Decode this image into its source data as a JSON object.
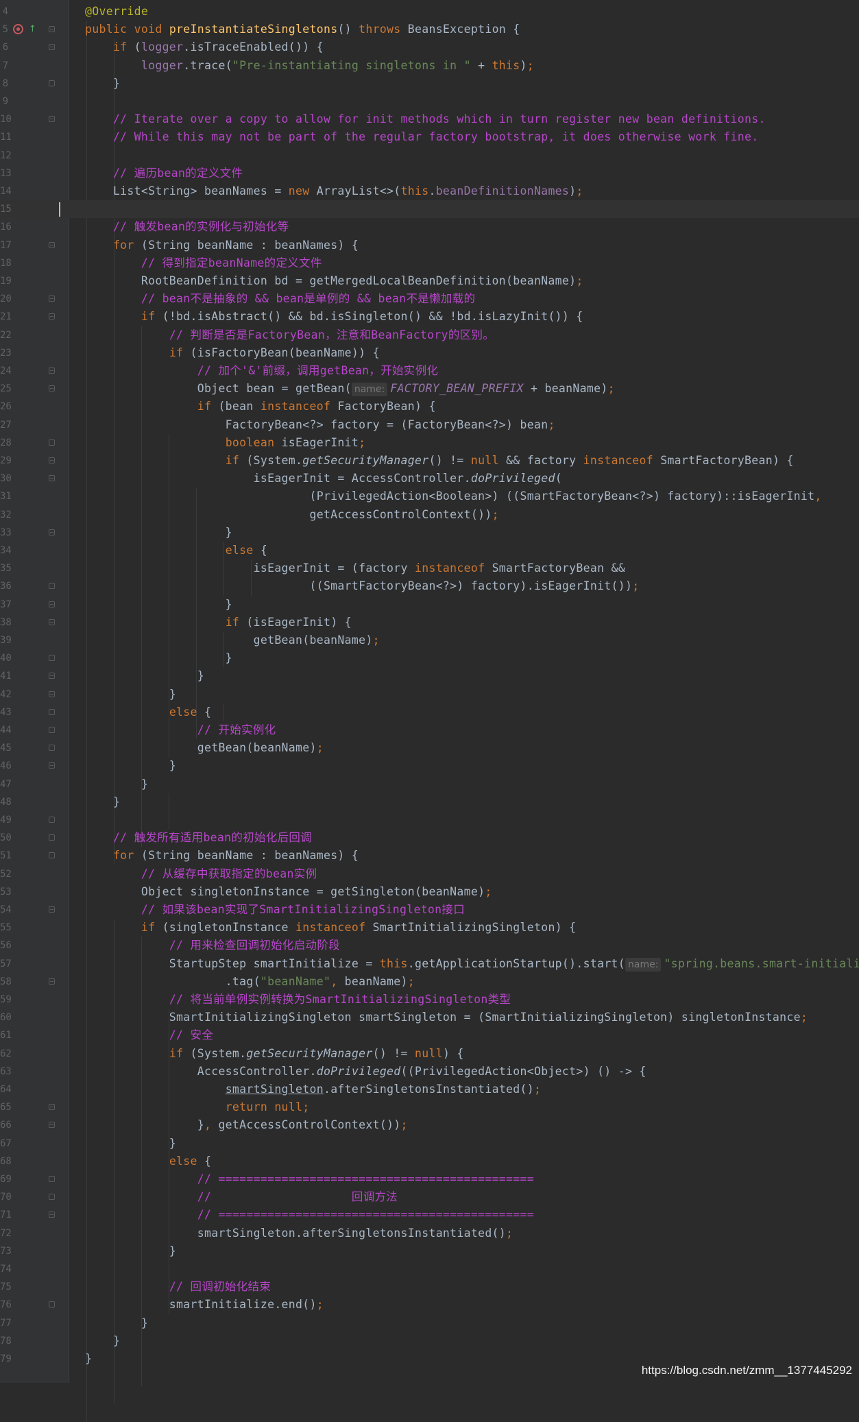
{
  "editor": {
    "lines": [
      {
        "n": "4",
        "t": [
          [
            "an",
            "@Override"
          ]
        ]
      },
      {
        "n": "5",
        "t": [
          [
            "kw",
            "public "
          ],
          [
            "kw",
            "void "
          ],
          [
            "fn",
            "preInstantiateSingletons"
          ],
          [
            "",
            "() "
          ],
          [
            "kw",
            "throws "
          ],
          [
            "",
            "BeansException {"
          ]
        ]
      },
      {
        "n": "6",
        "t": [
          [
            "",
            "    "
          ],
          [
            "kw",
            "if "
          ],
          [
            "",
            "("
          ],
          [
            "fd",
            "logger"
          ],
          [
            "",
            ".isTraceEnabled()) {"
          ]
        ]
      },
      {
        "n": "7",
        "t": [
          [
            "",
            "        "
          ],
          [
            "fd",
            "logger"
          ],
          [
            "",
            ".trace("
          ],
          [
            "st",
            "\"Pre-instantiating singletons in \" "
          ],
          [
            "",
            "+ "
          ],
          [
            "kw",
            "this"
          ],
          [
            "",
            ")"
          ],
          [
            "kw",
            ";"
          ]
        ]
      },
      {
        "n": "8",
        "t": [
          [
            "",
            "    }"
          ]
        ]
      },
      {
        "n": "9",
        "t": []
      },
      {
        "n": "10",
        "t": [
          [
            "",
            "    "
          ],
          [
            "cm",
            "// Iterate over a copy to allow for init methods which in turn register new bean definitions."
          ]
        ]
      },
      {
        "n": "11",
        "t": [
          [
            "",
            "    "
          ],
          [
            "cm",
            "// While this may not be part of the regular factory bootstrap, it does otherwise work fine."
          ]
        ]
      },
      {
        "n": "12",
        "t": []
      },
      {
        "n": "13",
        "t": [
          [
            "",
            "    "
          ],
          [
            "cm",
            "// 遍历bean的定义文件"
          ]
        ]
      },
      {
        "n": "14",
        "t": [
          [
            "",
            "    List<String> beanNames = "
          ],
          [
            "kw",
            "new "
          ],
          [
            "",
            "ArrayList<>("
          ],
          [
            "kw",
            "this"
          ],
          [
            "",
            "."
          ],
          [
            "fd",
            "beanDefinitionNames"
          ],
          [
            "",
            ")"
          ],
          [
            "kw",
            ";"
          ]
        ]
      },
      {
        "n": "15",
        "t": []
      },
      {
        "n": "16",
        "t": [
          [
            "",
            "    "
          ],
          [
            "cm",
            "// 触发bean的实例化与初始化等"
          ]
        ]
      },
      {
        "n": "17",
        "t": [
          [
            "",
            "    "
          ],
          [
            "kw",
            "for "
          ],
          [
            "",
            "(String beanName : beanNames) {"
          ]
        ]
      },
      {
        "n": "18",
        "t": [
          [
            "",
            "        "
          ],
          [
            "cm",
            "// 得到指定beanName的定义文件"
          ]
        ]
      },
      {
        "n": "19",
        "t": [
          [
            "",
            "        RootBeanDefinition bd = getMergedLocalBeanDefinition(beanName)"
          ],
          [
            "kw",
            ";"
          ]
        ]
      },
      {
        "n": "20",
        "t": [
          [
            "",
            "        "
          ],
          [
            "cm",
            "// bean不是抽象的 && bean是单例的 && bean不是懒加载的"
          ]
        ]
      },
      {
        "n": "21",
        "t": [
          [
            "",
            "        "
          ],
          [
            "kw",
            "if "
          ],
          [
            "",
            "(!bd.isAbstract() && bd.isSingleton() && !bd.isLazyInit()) {"
          ]
        ]
      },
      {
        "n": "22",
        "t": [
          [
            "",
            "            "
          ],
          [
            "cm",
            "// 判断是否是FactoryBean，注意和BeanFactory的区别。"
          ]
        ]
      },
      {
        "n": "23",
        "t": [
          [
            "",
            "            "
          ],
          [
            "kw",
            "if "
          ],
          [
            "",
            "(isFactoryBean(beanName)) {"
          ]
        ]
      },
      {
        "n": "24",
        "t": [
          [
            "",
            "                "
          ],
          [
            "cm",
            "// 加个'&'前缀，调用getBean，开始实例化"
          ]
        ]
      },
      {
        "n": "25",
        "t": [
          [
            "",
            "                Object bean = getBean("
          ],
          [
            "hint",
            "name:"
          ],
          [
            "cs",
            "FACTORY_BEAN_PREFIX "
          ],
          [
            "",
            "+ beanName)"
          ],
          [
            "kw",
            ";"
          ]
        ]
      },
      {
        "n": "26",
        "t": [
          [
            "",
            "                "
          ],
          [
            "kw",
            "if "
          ],
          [
            "",
            "(bean "
          ],
          [
            "kw",
            "instanceof "
          ],
          [
            "",
            "FactoryBean) {"
          ]
        ]
      },
      {
        "n": "27",
        "t": [
          [
            "",
            "                    FactoryBean<?> factory = (FactoryBean<?>) bean"
          ],
          [
            "kw",
            ";"
          ]
        ]
      },
      {
        "n": "28",
        "t": [
          [
            "",
            "                    "
          ],
          [
            "kw",
            "boolean "
          ],
          [
            "",
            "isEagerInit"
          ],
          [
            "kw",
            ";"
          ]
        ]
      },
      {
        "n": "29",
        "t": [
          [
            "",
            "                    "
          ],
          [
            "kw",
            "if "
          ],
          [
            "",
            "(System."
          ],
          [
            "sm",
            "getSecurityManager"
          ],
          [
            "",
            "() != "
          ],
          [
            "kw",
            "null "
          ],
          [
            "",
            "&& factory "
          ],
          [
            "kw",
            "instanceof "
          ],
          [
            "",
            "SmartFactoryBean) {"
          ]
        ]
      },
      {
        "n": "30",
        "t": [
          [
            "",
            "                        isEagerInit = AccessController."
          ],
          [
            "sm",
            "doPrivileged"
          ],
          [
            "",
            "("
          ]
        ]
      },
      {
        "n": "31",
        "t": [
          [
            "",
            "                                (PrivilegedAction<Boolean>) ((SmartFactoryBean<?>) factory)::isEagerInit"
          ],
          [
            "kw",
            ","
          ]
        ]
      },
      {
        "n": "32",
        "t": [
          [
            "",
            "                                getAccessControlContext())"
          ],
          [
            "kw",
            ";"
          ]
        ]
      },
      {
        "n": "33",
        "t": [
          [
            "",
            "                    }"
          ]
        ]
      },
      {
        "n": "34",
        "t": [
          [
            "",
            "                    "
          ],
          [
            "kw",
            "else "
          ],
          [
            "",
            "{"
          ]
        ]
      },
      {
        "n": "35",
        "t": [
          [
            "",
            "                        isEagerInit = (factory "
          ],
          [
            "kw",
            "instanceof "
          ],
          [
            "",
            "SmartFactoryBean &&"
          ]
        ]
      },
      {
        "n": "36",
        "t": [
          [
            "",
            "                                ((SmartFactoryBean<?>) factory).isEagerInit())"
          ],
          [
            "kw",
            ";"
          ]
        ]
      },
      {
        "n": "37",
        "t": [
          [
            "",
            "                    }"
          ]
        ]
      },
      {
        "n": "38",
        "t": [
          [
            "",
            "                    "
          ],
          [
            "kw",
            "if "
          ],
          [
            "",
            "(isEagerInit) {"
          ]
        ]
      },
      {
        "n": "39",
        "t": [
          [
            "",
            "                        getBean(beanName)"
          ],
          [
            "kw",
            ";"
          ]
        ]
      },
      {
        "n": "40",
        "t": [
          [
            "",
            "                    }"
          ]
        ]
      },
      {
        "n": "41",
        "t": [
          [
            "",
            "                }"
          ]
        ]
      },
      {
        "n": "42",
        "t": [
          [
            "",
            "            }"
          ]
        ]
      },
      {
        "n": "43",
        "t": [
          [
            "",
            "            "
          ],
          [
            "kw",
            "else "
          ],
          [
            "",
            "{"
          ]
        ]
      },
      {
        "n": "44",
        "t": [
          [
            "",
            "                "
          ],
          [
            "cm",
            "// 开始实例化"
          ]
        ]
      },
      {
        "n": "45",
        "t": [
          [
            "",
            "                getBean(beanName)"
          ],
          [
            "kw",
            ";"
          ]
        ]
      },
      {
        "n": "46",
        "t": [
          [
            "",
            "            }"
          ]
        ]
      },
      {
        "n": "47",
        "t": [
          [
            "",
            "        }"
          ]
        ]
      },
      {
        "n": "48",
        "t": [
          [
            "",
            "    }"
          ]
        ]
      },
      {
        "n": "49",
        "t": []
      },
      {
        "n": "50",
        "t": [
          [
            "",
            "    "
          ],
          [
            "cm",
            "// 触发所有适用bean的初始化后回调"
          ]
        ]
      },
      {
        "n": "51",
        "t": [
          [
            "",
            "    "
          ],
          [
            "kw",
            "for "
          ],
          [
            "",
            "(String beanName : beanNames) {"
          ]
        ]
      },
      {
        "n": "52",
        "t": [
          [
            "",
            "        "
          ],
          [
            "cm",
            "// 从缓存中获取指定的bean实例"
          ]
        ]
      },
      {
        "n": "53",
        "t": [
          [
            "",
            "        Object singletonInstance = getSingleton(beanName)"
          ],
          [
            "kw",
            ";"
          ]
        ]
      },
      {
        "n": "54",
        "t": [
          [
            "",
            "        "
          ],
          [
            "cm",
            "// 如果该bean实现了SmartInitializingSingleton接口"
          ]
        ]
      },
      {
        "n": "55",
        "t": [
          [
            "",
            "        "
          ],
          [
            "kw",
            "if "
          ],
          [
            "",
            "(singletonInstance "
          ],
          [
            "kw",
            "instanceof "
          ],
          [
            "",
            "SmartInitializingSingleton) {"
          ]
        ]
      },
      {
        "n": "56",
        "t": [
          [
            "",
            "            "
          ],
          [
            "cm",
            "// 用来检查回调初始化启动阶段"
          ]
        ]
      },
      {
        "n": "57",
        "t": [
          [
            "",
            "            StartupStep smartInitialize = "
          ],
          [
            "kw",
            "this"
          ],
          [
            "",
            ".getApplicationStartup().start("
          ],
          [
            "hint",
            "name:"
          ],
          [
            "st",
            "\"spring.beans.smart-initialize"
          ]
        ]
      },
      {
        "n": "58",
        "t": [
          [
            "",
            "                    .tag("
          ],
          [
            "st",
            "\"beanName\""
          ],
          [
            "kw",
            ", "
          ],
          [
            "",
            "beanName)"
          ],
          [
            "kw",
            ";"
          ]
        ]
      },
      {
        "n": "59",
        "t": [
          [
            "",
            "            "
          ],
          [
            "cm",
            "// 将当前单例实例转换为SmartInitializingSingleton类型"
          ]
        ]
      },
      {
        "n": "60",
        "t": [
          [
            "",
            "            SmartInitializingSingleton smartSingleton = (SmartInitializingSingleton) singletonInstance"
          ],
          [
            "kw",
            ";"
          ]
        ]
      },
      {
        "n": "61",
        "t": [
          [
            "",
            "            "
          ],
          [
            "cm",
            "// 安全"
          ]
        ]
      },
      {
        "n": "62",
        "t": [
          [
            "",
            "            "
          ],
          [
            "kw",
            "if "
          ],
          [
            "",
            "(System."
          ],
          [
            "sm",
            "getSecurityManager"
          ],
          [
            "",
            "() != "
          ],
          [
            "kw",
            "null"
          ],
          [
            "",
            ") {"
          ]
        ]
      },
      {
        "n": "63",
        "t": [
          [
            "",
            "                AccessController."
          ],
          [
            "sm",
            "doPrivileged"
          ],
          [
            "",
            "((PrivilegedAction<Object>) () -> {"
          ]
        ]
      },
      {
        "n": "64",
        "t": [
          [
            "",
            "                    "
          ],
          [
            "ul",
            "smartSingleton"
          ],
          [
            "",
            ".afterSingletonsInstantiated()"
          ],
          [
            "kw",
            ";"
          ]
        ]
      },
      {
        "n": "65",
        "t": [
          [
            "",
            "                    "
          ],
          [
            "kw",
            "return null;"
          ]
        ]
      },
      {
        "n": "66",
        "t": [
          [
            "",
            "                }"
          ],
          [
            "kw",
            ", "
          ],
          [
            "",
            "getAccessControlContext())"
          ],
          [
            "kw",
            ";"
          ]
        ]
      },
      {
        "n": "67",
        "t": [
          [
            "",
            "            }"
          ]
        ]
      },
      {
        "n": "68",
        "t": [
          [
            "",
            "            "
          ],
          [
            "kw",
            "else "
          ],
          [
            "",
            "{"
          ]
        ]
      },
      {
        "n": "69",
        "t": [
          [
            "",
            "                "
          ],
          [
            "cm",
            "// ============================================="
          ]
        ]
      },
      {
        "n": "70",
        "t": [
          [
            "",
            "                "
          ],
          [
            "cm",
            "//                    回调方法"
          ]
        ]
      },
      {
        "n": "71",
        "t": [
          [
            "",
            "                "
          ],
          [
            "cm",
            "// ============================================="
          ]
        ]
      },
      {
        "n": "72",
        "t": [
          [
            "",
            "                smartSingleton.afterSingletonsInstantiated()"
          ],
          [
            "kw",
            ";"
          ]
        ]
      },
      {
        "n": "73",
        "t": [
          [
            "",
            "            }"
          ]
        ]
      },
      {
        "n": "74",
        "t": []
      },
      {
        "n": "75",
        "t": [
          [
            "",
            "            "
          ],
          [
            "cm",
            "// 回调初始化结束"
          ]
        ]
      },
      {
        "n": "76",
        "t": [
          [
            "",
            "            smartInitialize.end()"
          ],
          [
            "kw",
            ";"
          ]
        ]
      },
      {
        "n": "77",
        "t": [
          [
            "",
            "        }"
          ]
        ]
      },
      {
        "n": "78",
        "t": [
          [
            "",
            "    }"
          ]
        ]
      },
      {
        "n": "79",
        "t": [
          [
            "",
            "}"
          ]
        ]
      }
    ]
  },
  "watermark": "https://blog.csdn.net/zmm__1377445292",
  "colors": {
    "background": "#2b2b2b",
    "keyword": "#cc7832",
    "annotation": "#bbb529",
    "method_decl": "#ffc66d",
    "field": "#9876aa",
    "string": "#6a8759",
    "comment": "#b646c9",
    "text": "#a9b7c6"
  },
  "icons": {
    "gutter_override": "override-breakpoint-icon",
    "gutter_implements": "implements-up-arrow-icon"
  }
}
